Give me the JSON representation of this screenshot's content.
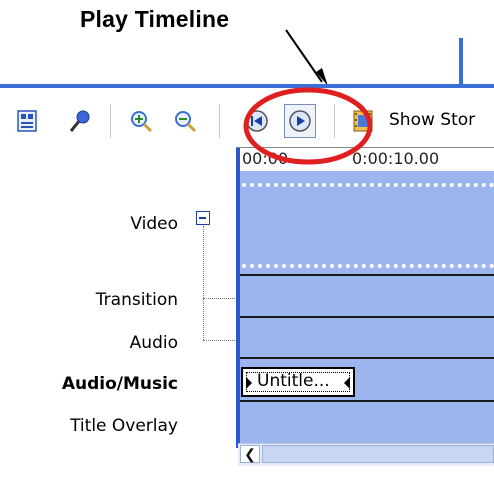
{
  "annotation": {
    "title": "Play Timeline",
    "highlight_color": "#e02020"
  },
  "toolbar": {
    "items": [
      {
        "name": "storyboard-toggle-icon"
      },
      {
        "name": "narrate-microphone-icon"
      },
      {
        "name": "zoom-in-icon"
      },
      {
        "name": "zoom-out-icon"
      },
      {
        "name": "rewind-timeline-icon"
      },
      {
        "name": "play-timeline-icon"
      },
      {
        "name": "filmstrip-icon"
      }
    ],
    "show_storyboard_label": "Show Stor"
  },
  "ruler": {
    "labels": [
      "00:00",
      "0:00:10.00"
    ]
  },
  "tracks": {
    "video": "Video",
    "transition": "Transition",
    "audio": "Audio",
    "audio_music": "Audio/Music",
    "title_overlay": "Title Overlay"
  },
  "clip": {
    "label": "Untitle..."
  },
  "colors": {
    "accent": "#3a6fd8",
    "timeline_bg": "#9db5ee"
  }
}
